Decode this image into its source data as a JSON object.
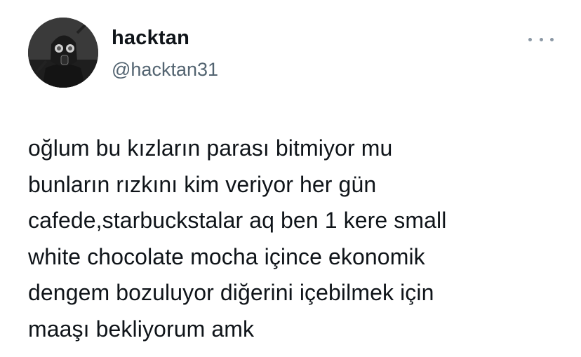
{
  "author": {
    "display_name": "hacktan",
    "handle": "@hacktan31",
    "avatar_icon": "gas-mask-avatar"
  },
  "menu": {
    "icon": "more-options-icon"
  },
  "tweet": {
    "lines": [
      "oğlum bu kızların parası bitmiyor mu",
      "bunların rızkını kim veriyor her gün",
      "cafede,starbuckstalar aq ben 1 kere small",
      "white chocolate mocha içince ekonomik",
      "dengem bozuluyor diğerini içebilmek için",
      "maaşı bekliyorum amk"
    ]
  },
  "colors": {
    "text": "#0f1419",
    "secondary_text": "#536471",
    "dots": "#8b98a5"
  }
}
